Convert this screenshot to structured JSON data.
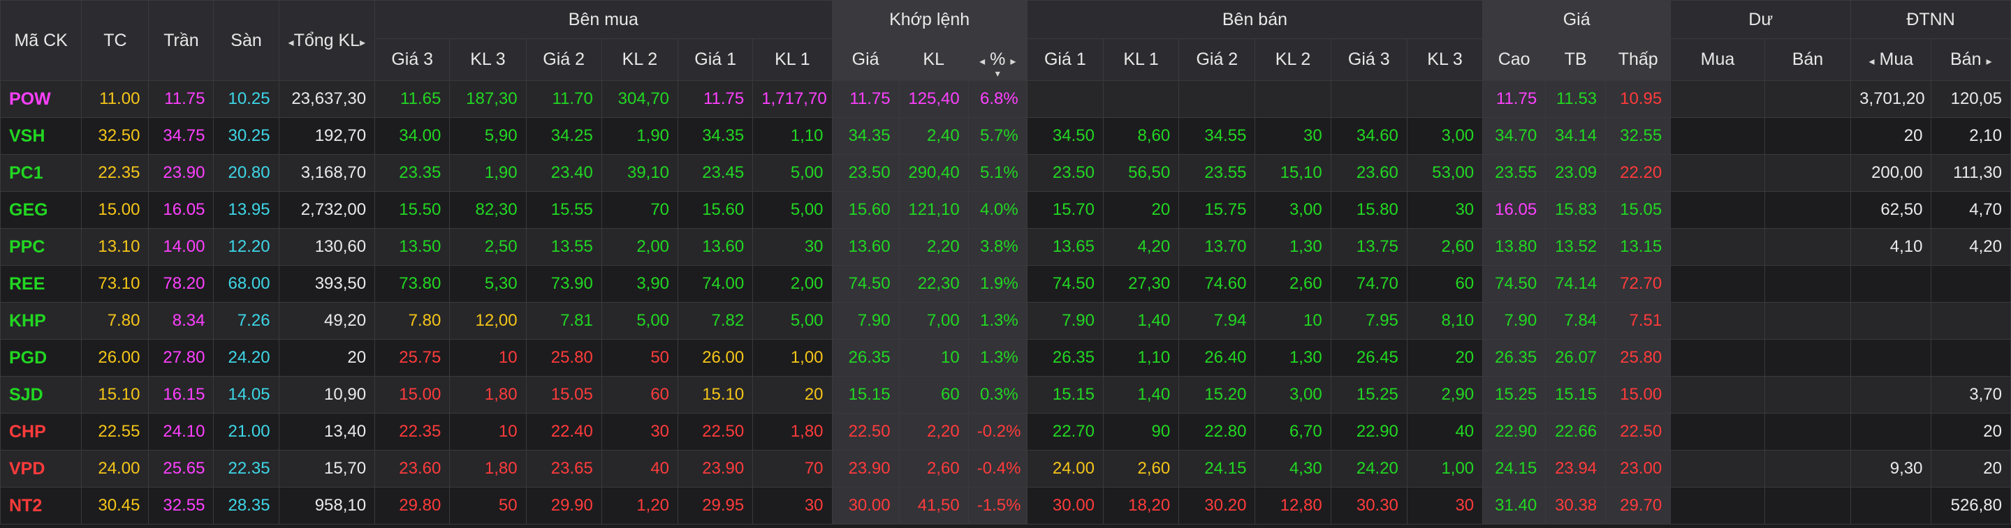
{
  "colors": {
    "ref": "#f5c518",
    "up": "#22d722",
    "down": "#ff3b3b",
    "ceil": "#ff40ff",
    "floor": "#3ed6e6",
    "white": "#eaeaea"
  },
  "header": {
    "symbol": "Mã CK",
    "ref": "TC",
    "ceil": "Trần",
    "floor": "Sàn",
    "total": "Tổng KL",
    "groups": {
      "buy": "Bên mua",
      "match": "Khớp lệnh",
      "sell": "Bên bán",
      "price": "Giá",
      "residual": "Dư",
      "foreign": "ĐTNN"
    },
    "buy_cols": [
      "Giá 3",
      "KL 3",
      "Giá 2",
      "KL 2",
      "Giá 1",
      "KL 1"
    ],
    "match_cols": [
      "Giá",
      "KL",
      "%"
    ],
    "sell_cols": [
      "Giá 1",
      "KL 1",
      "Giá 2",
      "KL 2",
      "Giá 3",
      "KL 3"
    ],
    "price_cols": [
      "Cao",
      "TB",
      "Thấp"
    ],
    "residual_cols": [
      "Mua",
      "Bán"
    ],
    "foreign_cols": [
      "Mua",
      "Bán"
    ],
    "arrows": {
      "left": "◂",
      "right": "▸",
      "down": "▾"
    }
  },
  "rows": [
    {
      "sym": "POW",
      "tc": "11.00",
      "tran": "11.75",
      "san": "10.25",
      "tkl": "23,637,30",
      "b3p": "11.65",
      "b3v": "187,30",
      "b2p": "11.70",
      "b2v": "304,70",
      "b1p": "11.75",
      "b1v": "1,717,70",
      "mp": "11.75",
      "mv": "125,40",
      "pct": "6.8%",
      "s1p": "",
      "s1v": "",
      "s2p": "",
      "s2v": "",
      "s3p": "",
      "s3v": "",
      "hi": "11.75",
      "avg": "11.53",
      "lo": "10.95",
      "rb": "",
      "rs": "",
      "fb": "3,701,20",
      "fs": "120,05"
    },
    {
      "sym": "VSH",
      "tc": "32.50",
      "tran": "34.75",
      "san": "30.25",
      "tkl": "192,70",
      "b3p": "34.00",
      "b3v": "5,90",
      "b2p": "34.25",
      "b2v": "1,90",
      "b1p": "34.35",
      "b1v": "1,10",
      "mp": "34.35",
      "mv": "2,40",
      "pct": "5.7%",
      "s1p": "34.50",
      "s1v": "8,60",
      "s2p": "34.55",
      "s2v": "30",
      "s3p": "34.60",
      "s3v": "3,00",
      "hi": "34.70",
      "avg": "34.14",
      "lo": "32.55",
      "rb": "",
      "rs": "",
      "fb": "20",
      "fs": "2,10"
    },
    {
      "sym": "PC1",
      "tc": "22.35",
      "tran": "23.90",
      "san": "20.80",
      "tkl": "3,168,70",
      "b3p": "23.35",
      "b3v": "1,90",
      "b2p": "23.40",
      "b2v": "39,10",
      "b1p": "23.45",
      "b1v": "5,00",
      "mp": "23.50",
      "mv": "290,40",
      "pct": "5.1%",
      "s1p": "23.50",
      "s1v": "56,50",
      "s2p": "23.55",
      "s2v": "15,10",
      "s3p": "23.60",
      "s3v": "53,00",
      "hi": "23.55",
      "avg": "23.09",
      "lo": "22.20",
      "rb": "",
      "rs": "",
      "fb": "200,00",
      "fs": "111,30"
    },
    {
      "sym": "GEG",
      "tc": "15.00",
      "tran": "16.05",
      "san": "13.95",
      "tkl": "2,732,00",
      "b3p": "15.50",
      "b3v": "82,30",
      "b2p": "15.55",
      "b2v": "70",
      "b1p": "15.60",
      "b1v": "5,00",
      "mp": "15.60",
      "mv": "121,10",
      "pct": "4.0%",
      "s1p": "15.70",
      "s1v": "20",
      "s2p": "15.75",
      "s2v": "3,00",
      "s3p": "15.80",
      "s3v": "30",
      "hi": "16.05",
      "avg": "15.83",
      "lo": "15.05",
      "rb": "",
      "rs": "",
      "fb": "62,50",
      "fs": "4,70"
    },
    {
      "sym": "PPC",
      "tc": "13.10",
      "tran": "14.00",
      "san": "12.20",
      "tkl": "130,60",
      "b3p": "13.50",
      "b3v": "2,50",
      "b2p": "13.55",
      "b2v": "2,00",
      "b1p": "13.60",
      "b1v": "30",
      "mp": "13.60",
      "mv": "2,20",
      "pct": "3.8%",
      "s1p": "13.65",
      "s1v": "4,20",
      "s2p": "13.70",
      "s2v": "1,30",
      "s3p": "13.75",
      "s3v": "2,60",
      "hi": "13.80",
      "avg": "13.52",
      "lo": "13.15",
      "rb": "",
      "rs": "",
      "fb": "4,10",
      "fs": "4,20"
    },
    {
      "sym": "REE",
      "tc": "73.10",
      "tran": "78.20",
      "san": "68.00",
      "tkl": "393,50",
      "b3p": "73.80",
      "b3v": "5,30",
      "b2p": "73.90",
      "b2v": "3,90",
      "b1p": "74.00",
      "b1v": "2,00",
      "mp": "74.50",
      "mv": "22,30",
      "pct": "1.9%",
      "s1p": "74.50",
      "s1v": "27,30",
      "s2p": "74.60",
      "s2v": "2,60",
      "s3p": "74.70",
      "s3v": "60",
      "hi": "74.50",
      "avg": "74.14",
      "lo": "72.70",
      "rb": "",
      "rs": "",
      "fb": "",
      "fs": ""
    },
    {
      "sym": "KHP",
      "tc": "7.80",
      "tran": "8.34",
      "san": "7.26",
      "tkl": "49,20",
      "b3p": "7.80",
      "b3v": "12,00",
      "b2p": "7.81",
      "b2v": "5,00",
      "b1p": "7.82",
      "b1v": "5,00",
      "mp": "7.90",
      "mv": "7,00",
      "pct": "1.3%",
      "s1p": "7.90",
      "s1v": "1,40",
      "s2p": "7.94",
      "s2v": "10",
      "s3p": "7.95",
      "s3v": "8,10",
      "hi": "7.90",
      "avg": "7.84",
      "lo": "7.51",
      "rb": "",
      "rs": "",
      "fb": "",
      "fs": ""
    },
    {
      "sym": "PGD",
      "tc": "26.00",
      "tran": "27.80",
      "san": "24.20",
      "tkl": "20",
      "b3p": "25.75",
      "b3v": "10",
      "b2p": "25.80",
      "b2v": "50",
      "b1p": "26.00",
      "b1v": "1,00",
      "mp": "26.35",
      "mv": "10",
      "pct": "1.3%",
      "s1p": "26.35",
      "s1v": "1,10",
      "s2p": "26.40",
      "s2v": "1,30",
      "s3p": "26.45",
      "s3v": "20",
      "hi": "26.35",
      "avg": "26.07",
      "lo": "25.80",
      "rb": "",
      "rs": "",
      "fb": "",
      "fs": ""
    },
    {
      "sym": "SJD",
      "tc": "15.10",
      "tran": "16.15",
      "san": "14.05",
      "tkl": "10,90",
      "b3p": "15.00",
      "b3v": "1,80",
      "b2p": "15.05",
      "b2v": "60",
      "b1p": "15.10",
      "b1v": "20",
      "mp": "15.15",
      "mv": "60",
      "pct": "0.3%",
      "s1p": "15.15",
      "s1v": "1,40",
      "s2p": "15.20",
      "s2v": "3,00",
      "s3p": "15.25",
      "s3v": "2,90",
      "hi": "15.25",
      "avg": "15.15",
      "lo": "15.00",
      "rb": "",
      "rs": "",
      "fb": "",
      "fs": "3,70"
    },
    {
      "sym": "CHP",
      "tc": "22.55",
      "tran": "24.10",
      "san": "21.00",
      "tkl": "13,40",
      "b3p": "22.35",
      "b3v": "10",
      "b2p": "22.40",
      "b2v": "30",
      "b1p": "22.50",
      "b1v": "1,80",
      "mp": "22.50",
      "mv": "2,20",
      "pct": "-0.2%",
      "s1p": "22.70",
      "s1v": "90",
      "s2p": "22.80",
      "s2v": "6,70",
      "s3p": "22.90",
      "s3v": "40",
      "hi": "22.90",
      "avg": "22.66",
      "lo": "22.50",
      "rb": "",
      "rs": "",
      "fb": "",
      "fs": "20"
    },
    {
      "sym": "VPD",
      "tc": "24.00",
      "tran": "25.65",
      "san": "22.35",
      "tkl": "15,70",
      "b3p": "23.60",
      "b3v": "1,80",
      "b2p": "23.65",
      "b2v": "40",
      "b1p": "23.90",
      "b1v": "70",
      "mp": "23.90",
      "mv": "2,60",
      "pct": "-0.4%",
      "s1p": "24.00",
      "s1v": "2,60",
      "s2p": "24.15",
      "s2v": "4,30",
      "s3p": "24.20",
      "s3v": "1,00",
      "hi": "24.15",
      "avg": "23.94",
      "lo": "23.00",
      "rb": "",
      "rs": "",
      "fb": "9,30",
      "fs": "20"
    },
    {
      "sym": "NT2",
      "tc": "30.45",
      "tran": "32.55",
      "san": "28.35",
      "tkl": "958,10",
      "b3p": "29.80",
      "b3v": "50",
      "b2p": "29.90",
      "b2v": "1,20",
      "b1p": "29.95",
      "b1v": "30",
      "mp": "30.00",
      "mv": "41,50",
      "pct": "-1.5%",
      "s1p": "30.00",
      "s1v": "18,20",
      "s2p": "30.20",
      "s2v": "12,80",
      "s3p": "30.30",
      "s3v": "30",
      "hi": "31.40",
      "avg": "30.38",
      "lo": "29.70",
      "rb": "",
      "rs": "",
      "fb": "",
      "fs": "526,80"
    }
  ]
}
